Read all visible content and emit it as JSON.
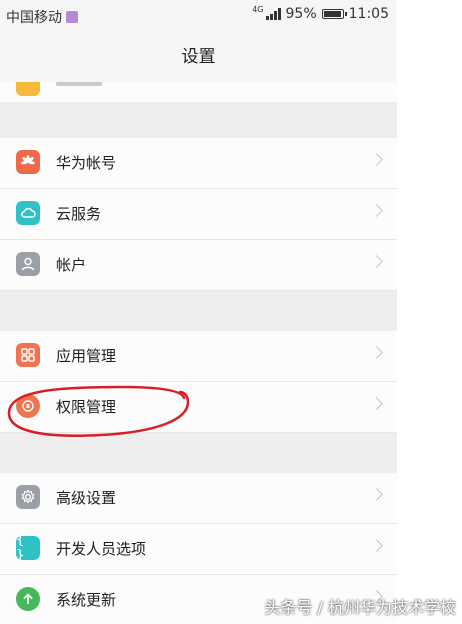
{
  "status": {
    "carrier": "中国移动",
    "network": "4G",
    "battery": "95%",
    "time": "11:05"
  },
  "title": "设置",
  "rows": [
    {
      "label": "华为帐号",
      "icon": "huawei-icon",
      "color": "#ef6a4a"
    },
    {
      "label": "云服务",
      "icon": "cloud-icon",
      "color": "#2fc1c6"
    },
    {
      "label": "帐户",
      "icon": "account-icon",
      "color": "#9aa0a6"
    },
    {
      "label": "应用管理",
      "icon": "apps-icon",
      "color": "#f0744f"
    },
    {
      "label": "权限管理",
      "icon": "permission-icon",
      "color": "#f0744f"
    },
    {
      "label": "高级设置",
      "icon": "gear-icon",
      "color": "#9aa0a6"
    },
    {
      "label": "开发人员选项",
      "icon": "braces-icon",
      "color": "#2fc1c6"
    },
    {
      "label": "系统更新",
      "icon": "update-arrow-icon",
      "color": "#47b85a"
    }
  ],
  "watermark": "头条号 / 杭州华为技术学校"
}
